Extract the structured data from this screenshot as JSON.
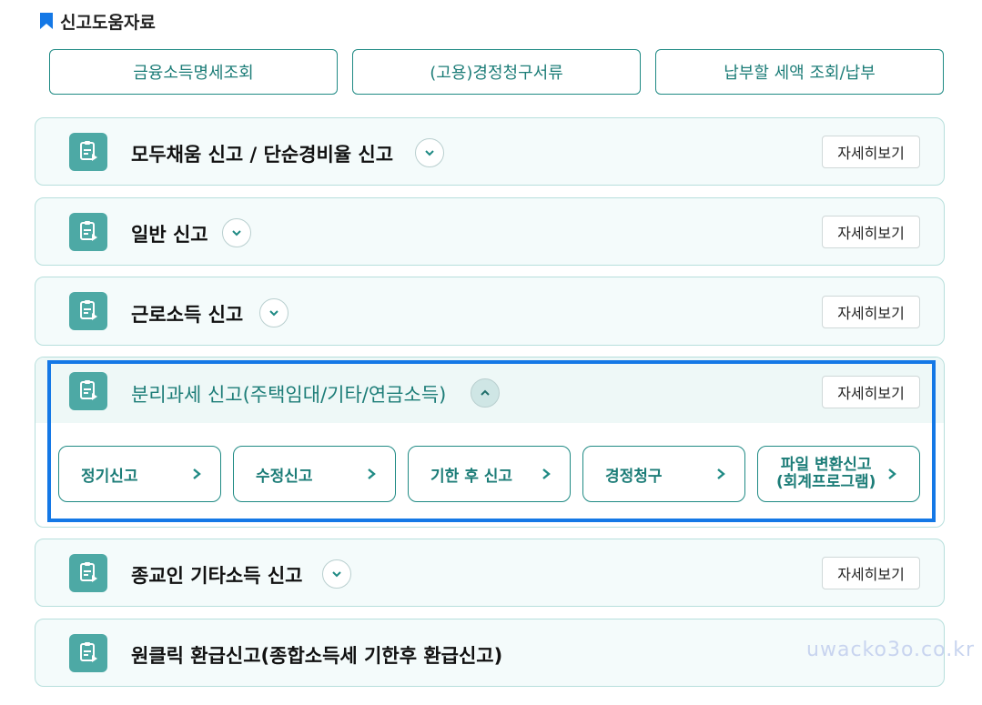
{
  "section": {
    "title": "신고도움자료"
  },
  "top_buttons": [
    "금융소득명세조회",
    "(고용)경정청구서류",
    "납부할 세액 조회/납부"
  ],
  "cards": [
    {
      "title": "모두채움 신고 / 단순경비율 신고",
      "detail": "자세히보기",
      "expanded": false
    },
    {
      "title": "일반 신고",
      "detail": "자세히보기",
      "expanded": false
    },
    {
      "title": "근로소득 신고",
      "detail": "자세히보기",
      "expanded": false
    },
    {
      "title": "분리과세 신고(주택임대/기타/연금소득)",
      "detail": "자세히보기",
      "expanded": true,
      "sub_items": [
        "정기신고",
        "수정신고",
        "기한 후 신고",
        "경정청구",
        "파일 변환신고",
        "(회계프로그램)"
      ]
    },
    {
      "title": "종교인 기타소득 신고",
      "detail": "자세히보기",
      "expanded": false
    },
    {
      "title": "원클릭 환급신고(종합소득세 기한후 환급신고)"
    }
  ],
  "watermark": "uwacko3o.co.kr",
  "colors": {
    "accent": "#1f8a84",
    "icon_bg": "#4da9a5",
    "highlight": "#1478e6"
  }
}
